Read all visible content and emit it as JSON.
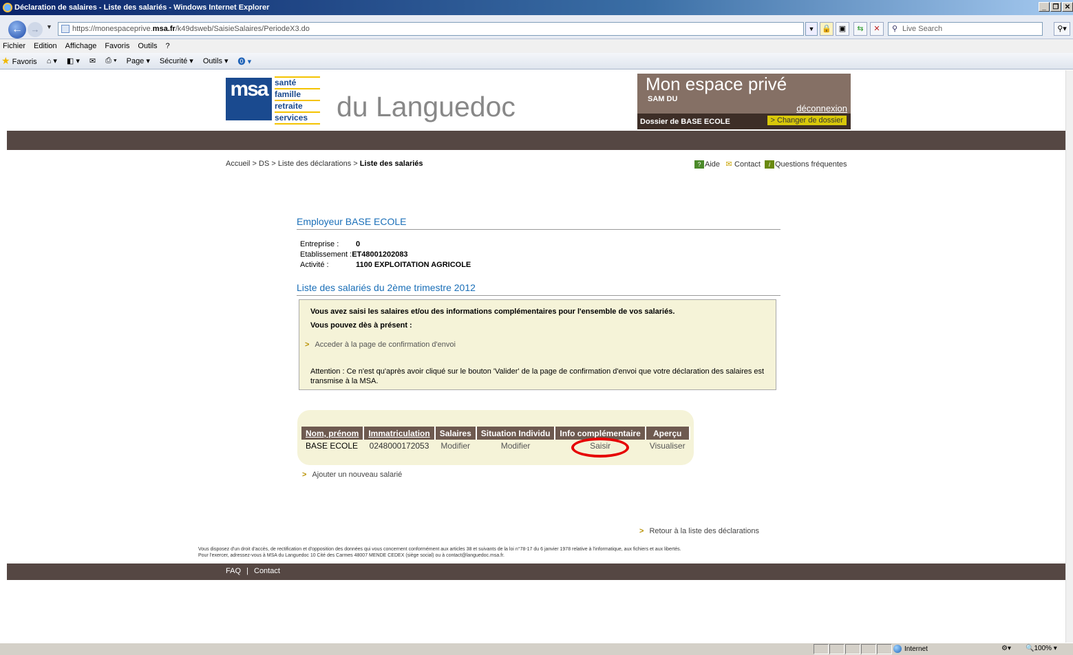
{
  "browser": {
    "window_title": "Déclaration de salaires - Liste des salariés - Windows Internet Explorer",
    "url_prefix": "https://monespaceprive.",
    "url_domain": "msa.fr",
    "url_path": "/k49dsweb/SaisieSalaires/PeriodeX3.do",
    "search_placeholder": "Live Search",
    "menu": [
      "Fichier",
      "Edition",
      "Affichage",
      "Favoris",
      "Outils",
      "?"
    ],
    "favorites_label": "Favoris",
    "cmd_page": "Page",
    "cmd_securite": "Sécurité",
    "cmd_outils": "Outils",
    "status_zone": "Internet",
    "status_zoom": "100%"
  },
  "header": {
    "logo_words": [
      "santé",
      "famille",
      "retraite",
      "services"
    ],
    "logo_mark": "msa",
    "region": "du Languedoc",
    "espace_title": "Mon espace privé",
    "user": "SAM DU",
    "logout": "déconnexion",
    "dossier": "Dossier de BASE ECOLE",
    "change_dossier": "> Changer de dossier"
  },
  "breadcrumb": {
    "home": "Accueil",
    "ds": "DS",
    "declarations": "Liste des déclarations",
    "current": "Liste des salariés",
    "sep": " > "
  },
  "help": {
    "aide": "Aide",
    "contact": "Contact",
    "faq": "Questions fréquentes"
  },
  "employer": {
    "title": "Employeur BASE ECOLE",
    "entreprise_label": "Entreprise :",
    "entreprise_value": "0",
    "etablissement_label": "Etablissement :",
    "etablissement_value": "ET48001202083",
    "activite_label": "Activité :",
    "activite_value": "1100 EXPLOITATION AGRICOLE"
  },
  "list_title": "Liste des salariés du 2ème trimestre 2012",
  "infobox": {
    "line1": "Vous avez saisi les salaires et/ou des informations complémentaires pour l'ensemble de vos salariés.",
    "line2": "Vous pouvez dès à présent :",
    "link": "Acceder à la page de confirmation d'envoi",
    "note": "Attention : Ce n'est qu'après avoir cliqué sur le bouton 'Valider' de la page de confirmation d'envoi que votre déclaration des salaires est transmise à la MSA."
  },
  "table": {
    "headers": [
      "Nom, prénom",
      "Immatriculation",
      "Salaires",
      "Situation Individu",
      "Info complémentaire",
      "Aperçu"
    ],
    "rows": [
      [
        "BASE ECOLE",
        "0248000172053",
        "Modifier",
        "Modifier",
        "Saisir",
        "Visualiser"
      ]
    ]
  },
  "add_employee": "Ajouter un nouveau salarié",
  "back_link": "Retour à la liste des déclarations",
  "legal": {
    "line1": "Vous disposez d'un droit d'accès, de rectification et d'opposition des données qui vous concernent conformément aux articles 38 et suivants de la loi n°78-17 du 6 janvier 1978 relative à l'informatique, aux fichiers et aux libertés.",
    "line2": "Pour l'exercer, adressez-vous à MSA du Languedoc 10 Cité des Carmes 48007 MENDE CEDEX (siège social) ou à contact@languedoc.msa.fr."
  },
  "footer": {
    "faq": "FAQ",
    "sep": "|",
    "contact": "Contact"
  },
  "colors": {
    "brown_bar": "#554743",
    "espace_bg": "#857065",
    "title_blue": "#1a6fb8",
    "info_bg": "#f5f3d8",
    "highlight_red": "#e60000"
  }
}
